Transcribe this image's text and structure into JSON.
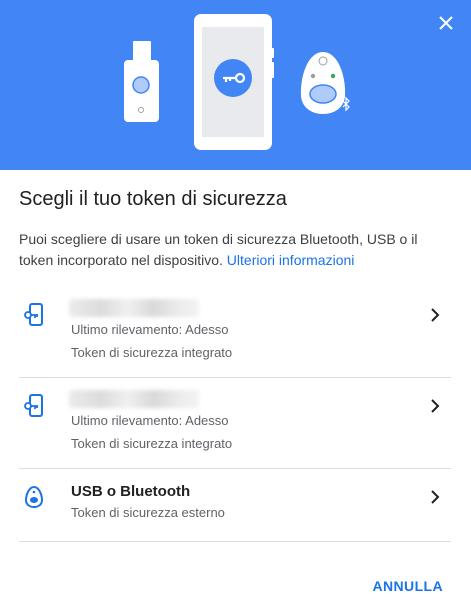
{
  "header": {
    "close_icon": "close-icon",
    "bg_color": "#4285f4"
  },
  "title": "Scegli il tuo token di sicurezza",
  "description": {
    "text": "Puoi scegliere di usare un token di sicurezza Bluetooth, USB o il token incorporato nel dispositivo.",
    "link": "Ulteriori informazioni"
  },
  "options": [
    {
      "icon": "phone-key-icon",
      "name": "",
      "line1": "Ultimo rilevamento: Adesso",
      "line2": "Token di sicurezza integrato"
    },
    {
      "icon": "phone-key-icon",
      "name": "",
      "line1": "Ultimo rilevamento: Adesso",
      "line2": "Token di sicurezza integrato"
    },
    {
      "icon": "security-key-icon",
      "name": "USB o Bluetooth",
      "line1": "Token di sicurezza esterno"
    }
  ],
  "cancel_label": "ANNULLA",
  "accent_color": "#1a73e8"
}
